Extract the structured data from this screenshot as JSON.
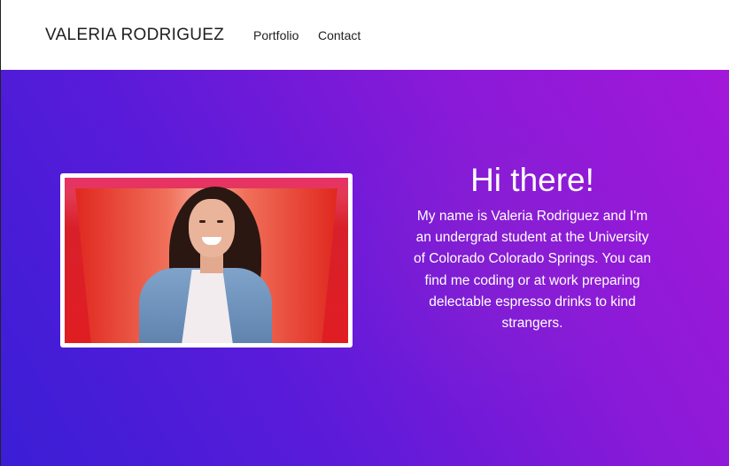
{
  "header": {
    "brand": "VALERIA RODRIGUEZ",
    "nav": [
      {
        "label": "Portfolio"
      },
      {
        "label": "Contact"
      }
    ]
  },
  "hero": {
    "title": "Hi there!",
    "bio": "My name is Valeria Rodriguez and I'm an undergrad student at the University of Colorado Colorado Springs. You can find me coding or at work preparing delectable espresso drinks to kind strangers.",
    "gradient_colors": [
      "#3a1ed6",
      "#a318d9"
    ]
  }
}
